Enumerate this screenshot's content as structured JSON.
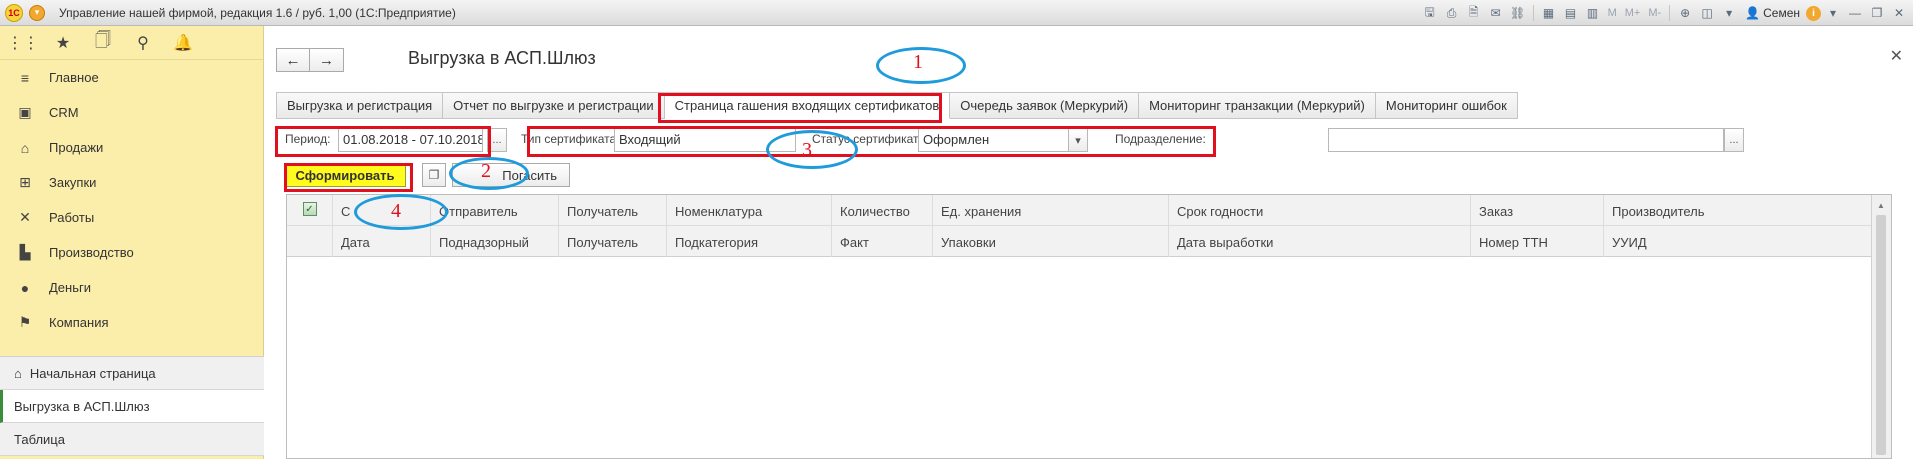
{
  "window": {
    "logo": "1С",
    "title": "Управление нашей фирмой, редакция 1.6 / руб. 1,00  (1С:Предприятие)",
    "toolbar_text": [
      "M",
      "M+",
      "M-"
    ],
    "user_name": "Семен"
  },
  "sidebar": {
    "items": [
      {
        "label": "Главное",
        "icon": "menu-lines-icon"
      },
      {
        "label": "CRM",
        "icon": "contact-card-icon"
      },
      {
        "label": "Продажи",
        "icon": "basket-icon"
      },
      {
        "label": "Закупки",
        "icon": "cart-icon"
      },
      {
        "label": "Работы",
        "icon": "tools-icon"
      },
      {
        "label": "Производство",
        "icon": "factory-icon"
      },
      {
        "label": "Деньги",
        "icon": "coin-icon"
      },
      {
        "label": "Компания",
        "icon": "flag-icon"
      }
    ],
    "open_windows": [
      {
        "label": "Начальная страница"
      },
      {
        "label": "Выгрузка в АСП.Шлюз"
      },
      {
        "label": "Таблица"
      }
    ]
  },
  "main": {
    "title": "Выгрузка в АСП.Шлюз",
    "tabs": [
      {
        "label": "Выгрузка и регистрация"
      },
      {
        "label": "Отчет по выгрузке и регистрации"
      },
      {
        "label": "Страница гашения входящих сертификатов"
      },
      {
        "label": "Очередь заявок (Меркурий)"
      },
      {
        "label": "Мониторинг транзакции (Меркурий)"
      },
      {
        "label": "Мониторинг ошибок"
      }
    ],
    "filters": {
      "period_label": "Период:",
      "period_value": "01.08.2018 - 07.10.2018",
      "cert_type_label": "Тип сертификата:",
      "cert_type_value": "Входящий",
      "cert_status_label": "Статус сертификата:",
      "cert_status_value": "Оформлен",
      "division_label": "Подразделение:",
      "division_value": "",
      "ellipsis": "..."
    },
    "commands": {
      "form_label": "Сформировать",
      "repay_label": "Погасить"
    },
    "table": {
      "header_row1": [
        "С",
        "Отправитель",
        "Получатель",
        "Номенклатура",
        "Количество",
        "Ед. хранения",
        "Срок годности",
        "Заказ",
        "Производитель"
      ],
      "header_row2": [
        "Дата",
        "Поднадзорный",
        "Получатель",
        "Подкатегория",
        "Факт",
        "Упаковки",
        "Дата выработки",
        "Номер ТТН",
        "УУИД"
      ]
    }
  },
  "annotations": {
    "labels": [
      "1",
      "2",
      "3",
      "4"
    ],
    "box_color": "#e0101e",
    "ellipse_color": "#1f9bdb"
  }
}
